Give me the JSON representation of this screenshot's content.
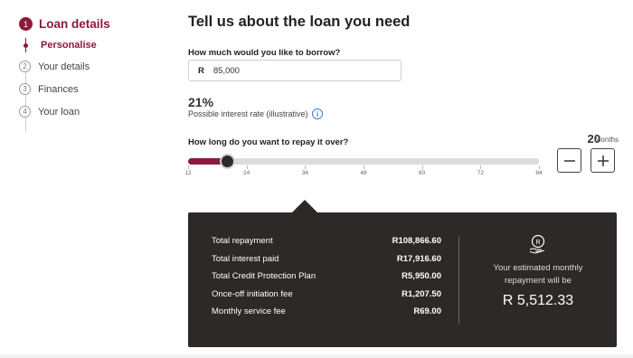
{
  "sidebar": {
    "steps": [
      {
        "number": "1",
        "label": "Loan details"
      },
      {
        "number": "",
        "label": "Personalise"
      },
      {
        "number": "2",
        "label": "Your details"
      },
      {
        "number": "3",
        "label": "Finances"
      },
      {
        "number": "4",
        "label": "Your loan"
      }
    ]
  },
  "main": {
    "title": "Tell us about the loan you need",
    "borrow_question": "How much would you like to borrow?",
    "currency_symbol": "R",
    "amount_value": "85,000",
    "interest_rate": "21%",
    "interest_label": "Possible interest rate (illustrative)",
    "repay_question": "How long do you want to repay it over?",
    "months_value": "20",
    "months_unit": "Months",
    "slider": {
      "min": 12,
      "max": 84,
      "value": 20,
      "ticks": [
        "12",
        "24",
        "36",
        "48",
        "60",
        "72",
        "84"
      ]
    }
  },
  "summary": {
    "rows": [
      {
        "label": "Total repayment",
        "value": "R108,866.60"
      },
      {
        "label": "Total interest paid",
        "value": "R17,916.60"
      },
      {
        "label": "Total Credit Protection Plan",
        "value": "R5,950.00"
      },
      {
        "label": "Once-off initiation fee",
        "value": "R1,207.50"
      },
      {
        "label": "Monthly service fee",
        "value": "R69.00"
      }
    ],
    "estimate_label": "Your estimated monthly repayment will be",
    "estimate_value": "R 5,512.33"
  },
  "colors": {
    "accent": "#8b1a3c",
    "panel_bg": "#2c2928"
  },
  "icons": [
    "info-icon",
    "minus-icon",
    "plus-icon",
    "coin-hand-icon"
  ]
}
